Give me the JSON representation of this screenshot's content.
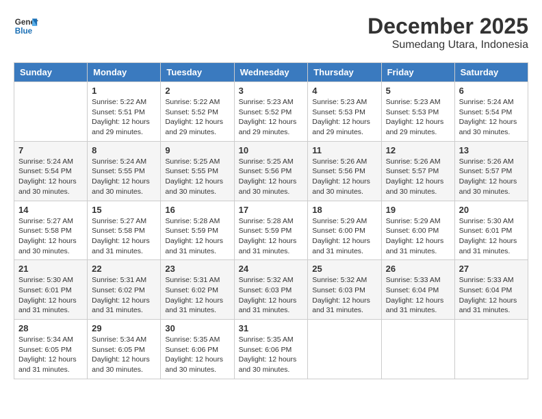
{
  "header": {
    "logo_line1": "General",
    "logo_line2": "Blue",
    "month": "December 2025",
    "location": "Sumedang Utara, Indonesia"
  },
  "weekdays": [
    "Sunday",
    "Monday",
    "Tuesday",
    "Wednesday",
    "Thursday",
    "Friday",
    "Saturday"
  ],
  "weeks": [
    [
      {
        "day": "",
        "info": ""
      },
      {
        "day": "1",
        "info": "Sunrise: 5:22 AM\nSunset: 5:51 PM\nDaylight: 12 hours\nand 29 minutes."
      },
      {
        "day": "2",
        "info": "Sunrise: 5:22 AM\nSunset: 5:52 PM\nDaylight: 12 hours\nand 29 minutes."
      },
      {
        "day": "3",
        "info": "Sunrise: 5:23 AM\nSunset: 5:52 PM\nDaylight: 12 hours\nand 29 minutes."
      },
      {
        "day": "4",
        "info": "Sunrise: 5:23 AM\nSunset: 5:53 PM\nDaylight: 12 hours\nand 29 minutes."
      },
      {
        "day": "5",
        "info": "Sunrise: 5:23 AM\nSunset: 5:53 PM\nDaylight: 12 hours\nand 29 minutes."
      },
      {
        "day": "6",
        "info": "Sunrise: 5:24 AM\nSunset: 5:54 PM\nDaylight: 12 hours\nand 30 minutes."
      }
    ],
    [
      {
        "day": "7",
        "info": "Sunrise: 5:24 AM\nSunset: 5:54 PM\nDaylight: 12 hours\nand 30 minutes."
      },
      {
        "day": "8",
        "info": "Sunrise: 5:24 AM\nSunset: 5:55 PM\nDaylight: 12 hours\nand 30 minutes."
      },
      {
        "day": "9",
        "info": "Sunrise: 5:25 AM\nSunset: 5:55 PM\nDaylight: 12 hours\nand 30 minutes."
      },
      {
        "day": "10",
        "info": "Sunrise: 5:25 AM\nSunset: 5:56 PM\nDaylight: 12 hours\nand 30 minutes."
      },
      {
        "day": "11",
        "info": "Sunrise: 5:26 AM\nSunset: 5:56 PM\nDaylight: 12 hours\nand 30 minutes."
      },
      {
        "day": "12",
        "info": "Sunrise: 5:26 AM\nSunset: 5:57 PM\nDaylight: 12 hours\nand 30 minutes."
      },
      {
        "day": "13",
        "info": "Sunrise: 5:26 AM\nSunset: 5:57 PM\nDaylight: 12 hours\nand 30 minutes."
      }
    ],
    [
      {
        "day": "14",
        "info": "Sunrise: 5:27 AM\nSunset: 5:58 PM\nDaylight: 12 hours\nand 30 minutes."
      },
      {
        "day": "15",
        "info": "Sunrise: 5:27 AM\nSunset: 5:58 PM\nDaylight: 12 hours\nand 31 minutes."
      },
      {
        "day": "16",
        "info": "Sunrise: 5:28 AM\nSunset: 5:59 PM\nDaylight: 12 hours\nand 31 minutes."
      },
      {
        "day": "17",
        "info": "Sunrise: 5:28 AM\nSunset: 5:59 PM\nDaylight: 12 hours\nand 31 minutes."
      },
      {
        "day": "18",
        "info": "Sunrise: 5:29 AM\nSunset: 6:00 PM\nDaylight: 12 hours\nand 31 minutes."
      },
      {
        "day": "19",
        "info": "Sunrise: 5:29 AM\nSunset: 6:00 PM\nDaylight: 12 hours\nand 31 minutes."
      },
      {
        "day": "20",
        "info": "Sunrise: 5:30 AM\nSunset: 6:01 PM\nDaylight: 12 hours\nand 31 minutes."
      }
    ],
    [
      {
        "day": "21",
        "info": "Sunrise: 5:30 AM\nSunset: 6:01 PM\nDaylight: 12 hours\nand 31 minutes."
      },
      {
        "day": "22",
        "info": "Sunrise: 5:31 AM\nSunset: 6:02 PM\nDaylight: 12 hours\nand 31 minutes."
      },
      {
        "day": "23",
        "info": "Sunrise: 5:31 AM\nSunset: 6:02 PM\nDaylight: 12 hours\nand 31 minutes."
      },
      {
        "day": "24",
        "info": "Sunrise: 5:32 AM\nSunset: 6:03 PM\nDaylight: 12 hours\nand 31 minutes."
      },
      {
        "day": "25",
        "info": "Sunrise: 5:32 AM\nSunset: 6:03 PM\nDaylight: 12 hours\nand 31 minutes."
      },
      {
        "day": "26",
        "info": "Sunrise: 5:33 AM\nSunset: 6:04 PM\nDaylight: 12 hours\nand 31 minutes."
      },
      {
        "day": "27",
        "info": "Sunrise: 5:33 AM\nSunset: 6:04 PM\nDaylight: 12 hours\nand 31 minutes."
      }
    ],
    [
      {
        "day": "28",
        "info": "Sunrise: 5:34 AM\nSunset: 6:05 PM\nDaylight: 12 hours\nand 31 minutes."
      },
      {
        "day": "29",
        "info": "Sunrise: 5:34 AM\nSunset: 6:05 PM\nDaylight: 12 hours\nand 30 minutes."
      },
      {
        "day": "30",
        "info": "Sunrise: 5:35 AM\nSunset: 6:06 PM\nDaylight: 12 hours\nand 30 minutes."
      },
      {
        "day": "31",
        "info": "Sunrise: 5:35 AM\nSunset: 6:06 PM\nDaylight: 12 hours\nand 30 minutes."
      },
      {
        "day": "",
        "info": ""
      },
      {
        "day": "",
        "info": ""
      },
      {
        "day": "",
        "info": ""
      }
    ]
  ]
}
